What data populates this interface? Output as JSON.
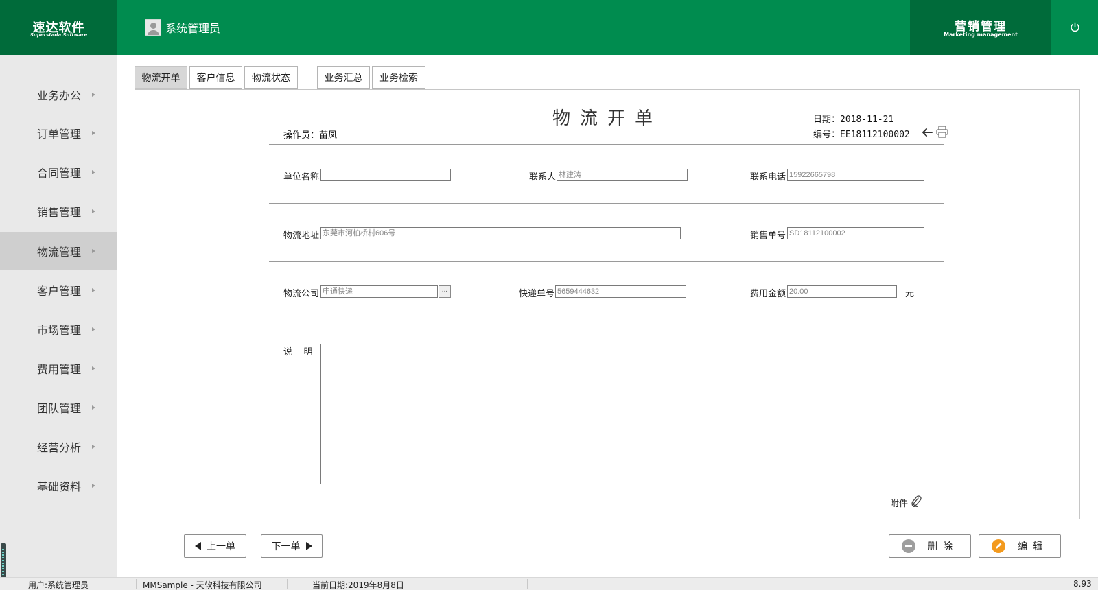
{
  "header": {
    "logo_title": "速达软件",
    "logo_subtitle": "Superstada Software",
    "user_name": "系统管理员",
    "module_title": "营销管理",
    "module_subtitle": "Marketing management",
    "header_color": "#008c4f",
    "accent_dark": "#006b3a"
  },
  "sidebar": {
    "items": [
      {
        "label": "业务办公",
        "active": false
      },
      {
        "label": "订单管理",
        "active": false
      },
      {
        "label": "合同管理",
        "active": false
      },
      {
        "label": "销售管理",
        "active": false
      },
      {
        "label": "物流管理",
        "active": true
      },
      {
        "label": "客户管理",
        "active": false
      },
      {
        "label": "市场管理",
        "active": false
      },
      {
        "label": "费用管理",
        "active": false
      },
      {
        "label": "团队管理",
        "active": false
      },
      {
        "label": "经营分析",
        "active": false
      },
      {
        "label": "基础资料",
        "active": false
      }
    ]
  },
  "tabs": [
    {
      "label": "物流开单",
      "active": true
    },
    {
      "label": "客户信息",
      "active": false
    },
    {
      "label": "物流状态",
      "active": false
    },
    {
      "label": "业务汇总",
      "active": false
    },
    {
      "label": "业务检索",
      "active": false
    }
  ],
  "form": {
    "title": "物流开单",
    "operator_label": "操作员：",
    "operator": "苗凤",
    "date_label": "日期：",
    "date": "2018-11-21",
    "number_label": "编号：",
    "number": "EE18112100002",
    "company_name_label": "单位名称",
    "company_name": "",
    "contact_label": "联系人",
    "contact": "林建涛",
    "phone_label": "联系电话",
    "phone": "15922665798",
    "address_label": "物流地址",
    "address": "东莞市河柏桥村606号",
    "sales_no_label": "销售单号",
    "sales_no": "SD18112100002",
    "logistics_company_label": "物流公司",
    "logistics_company": "申通快递",
    "browse_label": "...",
    "tracking_no_label": "快递单号",
    "tracking_no": "5659444632",
    "fee_label": "费用金额",
    "fee": "20.00",
    "fee_unit": "元",
    "description_label": "说    明",
    "description": "",
    "attachment_label": "附件"
  },
  "buttons": {
    "prev": "上一单",
    "next": "下一单",
    "delete": "删除",
    "edit": "编辑"
  },
  "status_bar": {
    "user": "用户:系统管理员",
    "app": "MMSample - 天软科技有限公司",
    "current_date": "当前日期:2019年8月8日",
    "version": "8.93"
  },
  "icons": {
    "power": "power-icon",
    "back": "back-arrow-icon",
    "print": "printer-icon",
    "attach": "paperclip-icon",
    "delete": "minus-circle-icon",
    "edit": "pencil-circle-icon"
  }
}
